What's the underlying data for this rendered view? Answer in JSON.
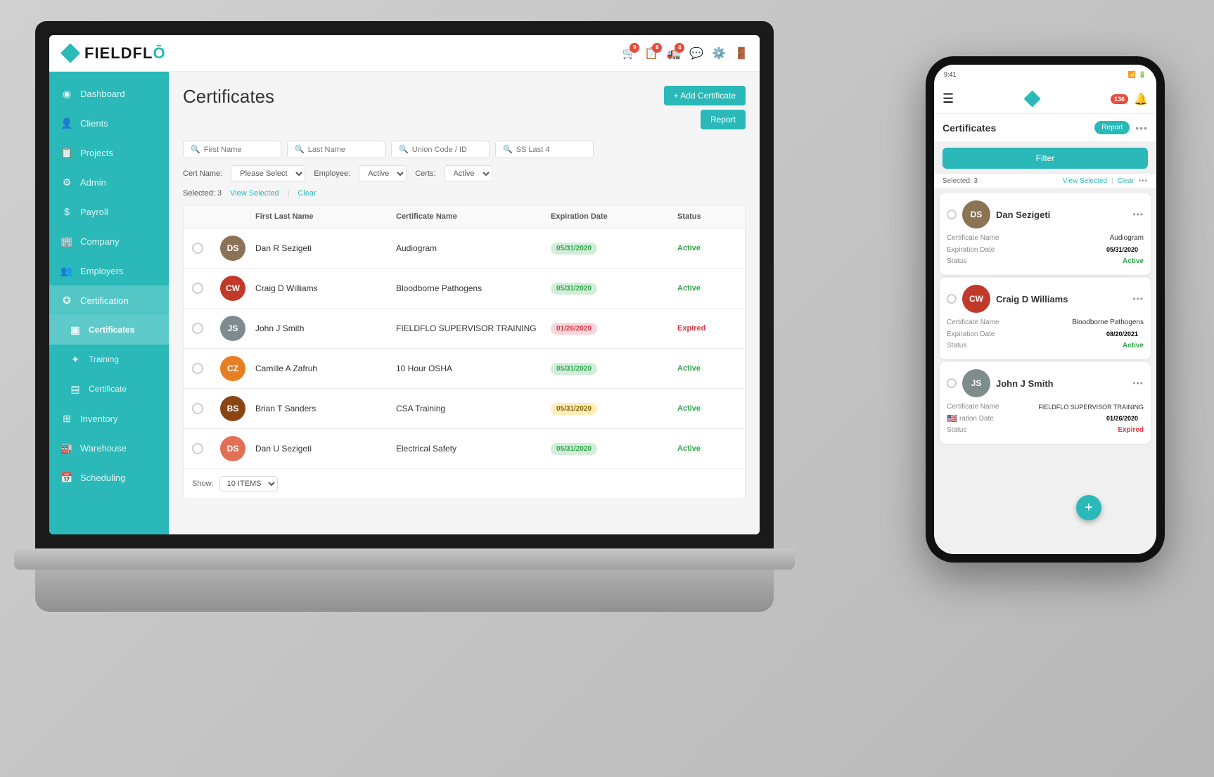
{
  "app": {
    "logo_text": "FIELDFL",
    "logo_accent": "Ō"
  },
  "topbar": {
    "icons": [
      "notification1",
      "notification2",
      "truck-icon",
      "chat-icon",
      "settings-icon",
      "logout-icon"
    ]
  },
  "sidebar": {
    "items": [
      {
        "id": "dashboard",
        "label": "Dashboard",
        "icon": "⊙"
      },
      {
        "id": "clients",
        "label": "Clients",
        "icon": "👤"
      },
      {
        "id": "projects",
        "label": "Projects",
        "icon": "📋"
      },
      {
        "id": "admin",
        "label": "Admin",
        "icon": "⚙"
      },
      {
        "id": "payroll",
        "label": "Payroll",
        "icon": "$"
      },
      {
        "id": "company",
        "label": "Company",
        "icon": "🏢"
      },
      {
        "id": "employers",
        "label": "Employers",
        "icon": "👥"
      },
      {
        "id": "certification",
        "label": "Certification",
        "icon": "✪",
        "active": true
      },
      {
        "id": "certificates",
        "label": "Certificates",
        "icon": "📄",
        "sub": true,
        "selected": true
      },
      {
        "id": "training",
        "label": "Training",
        "icon": "🎓",
        "sub": true
      },
      {
        "id": "certificate",
        "label": "Certificate",
        "icon": "📃",
        "sub": true
      },
      {
        "id": "inventory",
        "label": "Inventory",
        "icon": "📦"
      },
      {
        "id": "warehouse",
        "label": "Warehouse",
        "icon": "🏭"
      },
      {
        "id": "scheduling",
        "label": "Scheduling",
        "icon": "📅"
      }
    ]
  },
  "page": {
    "title": "Certificates",
    "add_button": "+ Add Certificate",
    "report_button": "Report",
    "selected_text": "Selected: 3",
    "view_selected": "View Selected",
    "clear": "Clear",
    "show_label": "Show:",
    "show_value": "10 ITEMS"
  },
  "filters": {
    "first_name_placeholder": "First Name",
    "last_name_placeholder": "Last Name",
    "union_code_placeholder": "Union Code / ID",
    "ss_last4_placeholder": "SS Last 4",
    "cert_name_label": "Cert Name:",
    "cert_name_value": "Please Select",
    "employee_label": "Employee:",
    "employee_value": "Active",
    "certs_label": "Certs:",
    "certs_value": "Active"
  },
  "table": {
    "headers": [
      "",
      "",
      "First Last Name",
      "Certificate Name",
      "Expiration Date",
      "Status"
    ],
    "rows": [
      {
        "name": "Dan R Sezigeti",
        "initials": "DS",
        "cert": "Audiogram",
        "exp_date": "05/31/2020",
        "exp_class": "green",
        "status": "Active",
        "status_class": "active",
        "avatar_color": "#8B7355"
      },
      {
        "name": "Craig D Williams",
        "initials": "CW",
        "cert": "Bloodborne Pathogens",
        "exp_date": "05/31/2020",
        "exp_class": "green",
        "status": "Active",
        "status_class": "active",
        "avatar_color": "#c0392b"
      },
      {
        "name": "John J Smith",
        "initials": "JS",
        "cert": "FIELDFLO SUPERVISOR TRAINING",
        "exp_date": "01/26/2020",
        "exp_class": "red",
        "status": "Expired",
        "status_class": "expired",
        "avatar_color": "#7f8c8d"
      },
      {
        "name": "Camille A Zafruh",
        "initials": "CZ",
        "cert": "10 Hour OSHA",
        "exp_date": "05/31/2020",
        "exp_class": "green",
        "status": "Active",
        "status_class": "active",
        "avatar_color": "#e67e22"
      },
      {
        "name": "Brian T Sanders",
        "initials": "BS",
        "cert": "CSA Training",
        "exp_date": "05/31/2020",
        "exp_class": "orange",
        "status": "Active",
        "status_class": "active",
        "avatar_color": "#8B4513"
      },
      {
        "name": "Dan U Sezigeti",
        "initials": "DS",
        "cert": "Electrical Safety",
        "exp_date": "05/31/2020",
        "exp_class": "green",
        "status": "Active",
        "status_class": "active",
        "avatar_color": "#e17055"
      }
    ]
  },
  "phone": {
    "title": "Certificates",
    "report_btn": "Report",
    "filter_btn": "Filter",
    "selected_text": "Selected: 3",
    "view_selected": "View Selected",
    "clear": "Clear",
    "notification_count": "136",
    "cards": [
      {
        "name": "Dan Sezigeti",
        "initials": "DS",
        "avatar_color": "#8B7355",
        "cert_label": "Certificate Name",
        "cert_value": "Audiogram",
        "exp_label": "Expiration Date",
        "exp_value": "05/31/2020",
        "exp_class": "green",
        "status_label": "Status",
        "status_value": "Active",
        "status_class": "active"
      },
      {
        "name": "Craig D Williams",
        "initials": "CW",
        "avatar_color": "#c0392b",
        "cert_label": "Certificate Name",
        "cert_value": "Bloodborne Pathogens",
        "exp_label": "Expiration Date",
        "exp_value": "08/20/2021",
        "exp_class": "green",
        "status_label": "Status",
        "status_value": "Active",
        "status_class": "active"
      },
      {
        "name": "John J Smith",
        "initials": "JS",
        "avatar_color": "#7f8c8d",
        "cert_label": "Certificate Name",
        "cert_value": "FIELDFLO SUPERVISOR TRAINING",
        "exp_label": "Expiration Date",
        "exp_value": "01/26/2020",
        "exp_class": "red",
        "status_label": "Status",
        "status_value": "Expired",
        "status_class": "expired"
      }
    ]
  }
}
